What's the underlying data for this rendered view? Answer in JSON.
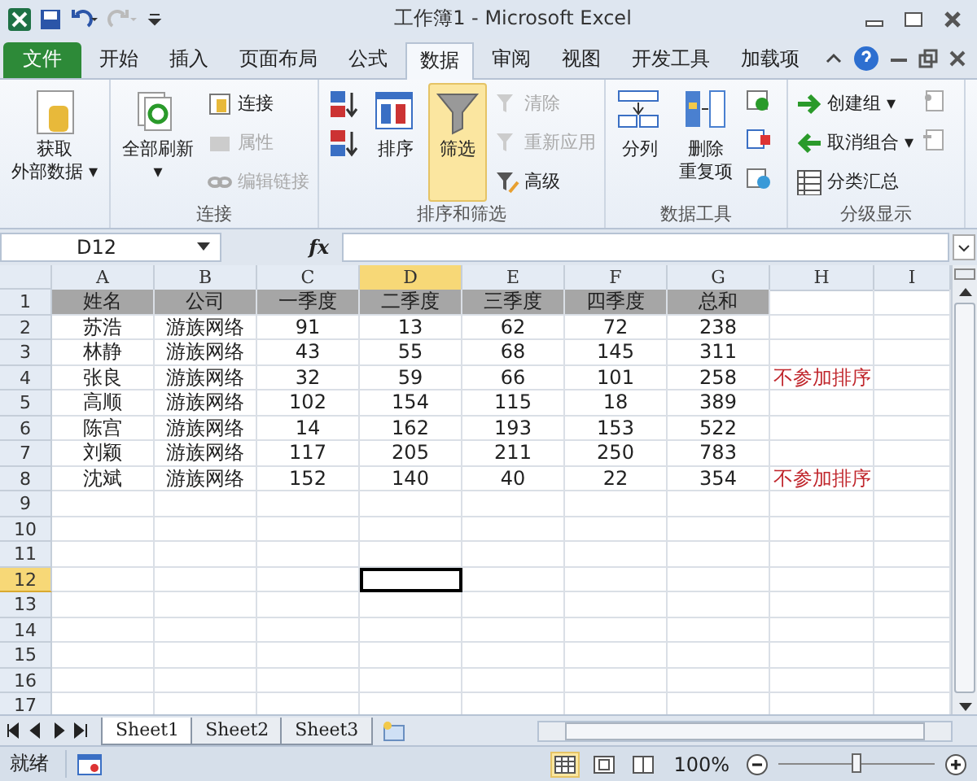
{
  "window": {
    "title": "工作簿1 - Microsoft Excel"
  },
  "tabs": [
    {
      "label": "文件",
      "kind": "file",
      "selected": false
    },
    {
      "label": "开始",
      "selected": false
    },
    {
      "label": "插入",
      "selected": false
    },
    {
      "label": "页面布局",
      "selected": false
    },
    {
      "label": "公式",
      "selected": false
    },
    {
      "label": "数据",
      "selected": true
    },
    {
      "label": "审阅",
      "selected": false
    },
    {
      "label": "视图",
      "selected": false
    },
    {
      "label": "开发工具",
      "selected": false
    },
    {
      "label": "加载项",
      "selected": false
    }
  ],
  "ribbon": [
    {
      "items": [
        {
          "kind": "large",
          "lines": [
            "获取",
            "外部数据 ▾"
          ],
          "disabled": false,
          "selected": false
        }
      ]
    },
    {
      "label": "连接",
      "items": [
        {
          "kind": "large",
          "lines": [
            "全部刷新",
            "▾"
          ],
          "disabled": false,
          "selected": false
        },
        {
          "kind": "small",
          "label": "连接",
          "disabled": false
        },
        {
          "kind": "small",
          "label": "属性",
          "disabled": true
        },
        {
          "kind": "small",
          "label": "编辑链接",
          "disabled": true
        }
      ]
    },
    {
      "label": "排序和筛选",
      "items": [
        {
          "kind": "icon",
          "disabled": false
        },
        {
          "kind": "icon",
          "disabled": false
        },
        {
          "kind": "large",
          "lines": [
            "排序"
          ],
          "disabled": false,
          "selected": false
        },
        {
          "kind": "large",
          "lines": [
            "筛选"
          ],
          "disabled": false,
          "selected": true
        },
        {
          "kind": "small",
          "label": "清除",
          "disabled": true
        },
        {
          "kind": "small",
          "label": "重新应用",
          "disabled": true
        },
        {
          "kind": "small",
          "label": "高级",
          "disabled": false
        }
      ]
    },
    {
      "label": "数据工具",
      "items": [
        {
          "kind": "large",
          "lines": [
            "分列"
          ],
          "disabled": false,
          "selected": false
        },
        {
          "kind": "large",
          "lines": [
            "删除",
            "重复项"
          ],
          "disabled": false,
          "selected": false
        },
        {
          "kind": "icon",
          "disabled": false
        },
        {
          "kind": "icon",
          "disabled": false
        },
        {
          "kind": "icon",
          "disabled": false
        }
      ]
    },
    {
      "label": "分级显示",
      "items": [
        {
          "kind": "small",
          "label": "创建组 ▾",
          "disabled": false
        },
        {
          "kind": "small",
          "label": "取消组合 ▾",
          "disabled": false
        },
        {
          "kind": "small",
          "label": "分类汇总",
          "disabled": false
        },
        {
          "kind": "icon",
          "disabled": false
        },
        {
          "kind": "icon",
          "disabled": false
        }
      ]
    }
  ],
  "formula_bar": {
    "name_box": "D12",
    "fx": "fx"
  },
  "columns": [
    {
      "label": "A",
      "selected": false
    },
    {
      "label": "B",
      "selected": false
    },
    {
      "label": "C",
      "selected": false
    },
    {
      "label": "D",
      "selected": true
    },
    {
      "label": "E",
      "selected": false
    },
    {
      "label": "F",
      "selected": false
    },
    {
      "label": "G",
      "selected": false
    },
    {
      "label": "H",
      "selected": false
    },
    {
      "label": "I",
      "selected": false
    }
  ],
  "rows": [
    {
      "number": "1",
      "header": true,
      "selected": false,
      "cells": [
        "姓名",
        "公司",
        "一季度",
        "二季度",
        "三季度",
        "四季度",
        "总和"
      ]
    },
    {
      "number": "2",
      "header": false,
      "selected": false,
      "cells": [
        "苏浩",
        "游族网络",
        "91",
        "13",
        "62",
        "72",
        "238"
      ]
    },
    {
      "number": "3",
      "header": false,
      "selected": false,
      "cells": [
        "林静",
        "游族网络",
        "43",
        "55",
        "68",
        "145",
        "311"
      ]
    },
    {
      "number": "4",
      "header": false,
      "selected": false,
      "cells": [
        "张良",
        "游族网络",
        "32",
        "59",
        "66",
        "101",
        "258"
      ],
      "note": "不参加排序"
    },
    {
      "number": "5",
      "header": false,
      "selected": false,
      "cells": [
        "高顺",
        "游族网络",
        "102",
        "154",
        "115",
        "18",
        "389"
      ]
    },
    {
      "number": "6",
      "header": false,
      "selected": false,
      "cells": [
        "陈宫",
        "游族网络",
        "14",
        "162",
        "193",
        "153",
        "522"
      ]
    },
    {
      "number": "7",
      "header": false,
      "selected": false,
      "cells": [
        "刘颖",
        "游族网络",
        "117",
        "205",
        "211",
        "250",
        "783"
      ]
    },
    {
      "number": "8",
      "header": false,
      "selected": false,
      "cells": [
        "沈斌",
        "游族网络",
        "152",
        "140",
        "40",
        "22",
        "354"
      ],
      "note": "不参加排序"
    },
    {
      "number": "9",
      "header": false,
      "selected": false
    },
    {
      "number": "10",
      "header": false,
      "selected": false
    },
    {
      "number": "11",
      "header": false,
      "selected": false
    },
    {
      "number": "12",
      "header": false,
      "selected": true
    },
    {
      "number": "13",
      "header": false,
      "selected": false
    },
    {
      "number": "14",
      "header": false,
      "selected": false
    },
    {
      "number": "15",
      "header": false,
      "selected": false
    },
    {
      "number": "16",
      "header": false,
      "selected": false
    },
    {
      "number": "17",
      "header": false,
      "selected": false
    }
  ],
  "sheet_tabs": [
    {
      "label": "Sheet1",
      "selected": true
    },
    {
      "label": "Sheet2",
      "selected": false
    },
    {
      "label": "Sheet3",
      "selected": false
    }
  ],
  "status_bar": {
    "status": "就绪",
    "views": [
      {
        "selected": true
      },
      {
        "selected": false
      },
      {
        "selected": false
      }
    ],
    "zoom": "100%",
    "zoom_slider": {
      "level": 0.5
    }
  }
}
